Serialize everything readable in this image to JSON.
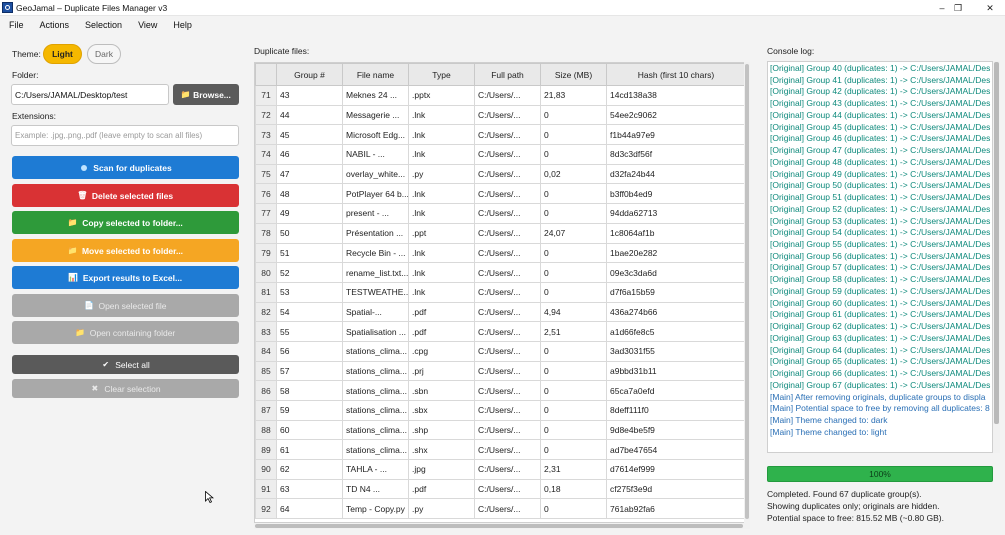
{
  "window": {
    "title": "GeoJamal – Duplicate Files Manager v3",
    "controls": {
      "minimize": "–",
      "maximize": "❐",
      "close": "✕"
    }
  },
  "menu": [
    "File",
    "Actions",
    "Selection",
    "View",
    "Help"
  ],
  "left": {
    "theme_label": "Theme:",
    "theme_light": "Light",
    "theme_dark": "Dark",
    "folder_label": "Folder:",
    "folder_value": "C:/Users/JAMAL/Desktop/test",
    "browse_label": "Browse...",
    "extensions_label": "Extensions:",
    "extensions_placeholder": "Example: .jpg,.png,.pdf (leave empty to scan all files)",
    "buttons": {
      "scan": "Scan for duplicates",
      "delete": "Delete selected files",
      "copy": "Copy selected to folder...",
      "move": "Move selected to folder...",
      "export": "Export results to Excel...",
      "open_file": "Open selected file",
      "open_folder": "Open containing folder",
      "select_all": "Select all",
      "clear_selection": "Clear selection"
    },
    "colors": {
      "scan": "#1e7bd4",
      "delete": "#d93234",
      "copy": "#2e9a3a",
      "move": "#f5a623",
      "export": "#1e7bd4",
      "select_all": "#5a5a5a",
      "clear_selection": "#a9a9a9",
      "theme_accent": "#f5b800"
    }
  },
  "table": {
    "title": "Duplicate files:",
    "columns": [
      "Group #",
      "File name",
      "Type",
      "Full path",
      "Size (MB)",
      "Hash (first 10 chars)"
    ],
    "rows": [
      [
        "71",
        "43",
        "Meknes 24 ...",
        ".pptx",
        "C:/Users/...",
        "21,83",
        "14cd138a38"
      ],
      [
        "72",
        "44",
        "Messagerie ...",
        ".lnk",
        "C:/Users/...",
        "0",
        "54ee2c9062"
      ],
      [
        "73",
        "45",
        "Microsoft Edg...",
        ".lnk",
        "C:/Users/...",
        "0",
        "f1b44a97e9"
      ],
      [
        "74",
        "46",
        "NABIL - ...",
        ".lnk",
        "C:/Users/...",
        "0",
        "8d3c3df56f"
      ],
      [
        "75",
        "47",
        "overlay_white...",
        ".py",
        "C:/Users/...",
        "0,02",
        "d32fa24b44"
      ],
      [
        "76",
        "48",
        "PotPlayer 64 b...",
        ".lnk",
        "C:/Users/...",
        "0",
        "b3ff0b4ed9"
      ],
      [
        "77",
        "49",
        "present - ...",
        ".lnk",
        "C:/Users/...",
        "0",
        "94dda62713"
      ],
      [
        "78",
        "50",
        "Présentation ...",
        ".ppt",
        "C:/Users/...",
        "24,07",
        "1c8064af1b"
      ],
      [
        "79",
        "51",
        "Recycle Bin - ...",
        ".lnk",
        "C:/Users/...",
        "0",
        "1bae20e282"
      ],
      [
        "80",
        "52",
        "rename_list.txt...",
        ".lnk",
        "C:/Users/...",
        "0",
        "09e3c3da6d"
      ],
      [
        "81",
        "53",
        "TESTWEATHE...",
        ".lnk",
        "C:/Users/...",
        "0",
        "d7f6a15b59"
      ],
      [
        "82",
        "54",
        "Spatial-...",
        ".pdf",
        "C:/Users/...",
        "4,94",
        "436a274b66"
      ],
      [
        "83",
        "55",
        "Spatialisation ...",
        ".pdf",
        "C:/Users/...",
        "2,51",
        "a1d66fe8c5"
      ],
      [
        "84",
        "56",
        "stations_clima...",
        ".cpg",
        "C:/Users/...",
        "0",
        "3ad3031f55"
      ],
      [
        "85",
        "57",
        "stations_clima...",
        ".prj",
        "C:/Users/...",
        "0",
        "a9bbd31b11"
      ],
      [
        "86",
        "58",
        "stations_clima...",
        ".sbn",
        "C:/Users/...",
        "0",
        "65ca7a0efd"
      ],
      [
        "87",
        "59",
        "stations_clima...",
        ".sbx",
        "C:/Users/...",
        "0",
        "8deff111f0"
      ],
      [
        "88",
        "60",
        "stations_clima...",
        ".shp",
        "C:/Users/...",
        "0",
        "9d8e4be5f9"
      ],
      [
        "89",
        "61",
        "stations_clima...",
        ".shx",
        "C:/Users/...",
        "0",
        "ad7be47654"
      ],
      [
        "90",
        "62",
        "TAHLA - ...",
        ".jpg",
        "C:/Users/...",
        "2,31",
        "d7614ef999"
      ],
      [
        "91",
        "63",
        "TD N4 ...",
        ".pdf",
        "C:/Users/...",
        "0,18",
        "cf275f3e9d"
      ],
      [
        "92",
        "64",
        "Temp - Copy.py",
        ".py",
        "C:/Users/...",
        "0",
        "761ab92fa6"
      ]
    ]
  },
  "console": {
    "title": "Console log:",
    "lines": [
      {
        "text": "[Original] Group 40 (duplicates: 1) -> C:/Users/JAMAL/Des",
        "kind": "original"
      },
      {
        "text": "[Original] Group 41 (duplicates: 1) -> C:/Users/JAMAL/Des",
        "kind": "original"
      },
      {
        "text": "[Original] Group 42 (duplicates: 1) -> C:/Users/JAMAL/Des",
        "kind": "original"
      },
      {
        "text": "[Original] Group 43 (duplicates: 1) -> C:/Users/JAMAL/Des",
        "kind": "original"
      },
      {
        "text": "[Original] Group 44 (duplicates: 1) -> C:/Users/JAMAL/Des",
        "kind": "original"
      },
      {
        "text": "[Original] Group 45 (duplicates: 1) -> C:/Users/JAMAL/Des",
        "kind": "original"
      },
      {
        "text": "[Original] Group 46 (duplicates: 1) -> C:/Users/JAMAL/Des",
        "kind": "original"
      },
      {
        "text": "[Original] Group 47 (duplicates: 1) -> C:/Users/JAMAL/Des",
        "kind": "original"
      },
      {
        "text": "[Original] Group 48 (duplicates: 1) -> C:/Users/JAMAL/Des",
        "kind": "original"
      },
      {
        "text": "[Original] Group 49 (duplicates: 1) -> C:/Users/JAMAL/Des",
        "kind": "original"
      },
      {
        "text": "[Original] Group 50 (duplicates: 1) -> C:/Users/JAMAL/Des",
        "kind": "original"
      },
      {
        "text": "[Original] Group 51 (duplicates: 1) -> C:/Users/JAMAL/Des",
        "kind": "original"
      },
      {
        "text": "[Original] Group 52 (duplicates: 1) -> C:/Users/JAMAL/Des",
        "kind": "original"
      },
      {
        "text": "[Original] Group 53 (duplicates: 1) -> C:/Users/JAMAL/Des",
        "kind": "original"
      },
      {
        "text": "[Original] Group 54 (duplicates: 1) -> C:/Users/JAMAL/Des",
        "kind": "original"
      },
      {
        "text": "[Original] Group 55 (duplicates: 1) -> C:/Users/JAMAL/Des",
        "kind": "original"
      },
      {
        "text": "[Original] Group 56 (duplicates: 1) -> C:/Users/JAMAL/Des",
        "kind": "original"
      },
      {
        "text": "[Original] Group 57 (duplicates: 1) -> C:/Users/JAMAL/Des",
        "kind": "original"
      },
      {
        "text": "[Original] Group 58 (duplicates: 1) -> C:/Users/JAMAL/Des",
        "kind": "original"
      },
      {
        "text": "[Original] Group 59 (duplicates: 1) -> C:/Users/JAMAL/Des",
        "kind": "original"
      },
      {
        "text": "[Original] Group 60 (duplicates: 1) -> C:/Users/JAMAL/Des",
        "kind": "original"
      },
      {
        "text": "[Original] Group 61 (duplicates: 1) -> C:/Users/JAMAL/Des",
        "kind": "original"
      },
      {
        "text": "[Original] Group 62 (duplicates: 1) -> C:/Users/JAMAL/Des",
        "kind": "original"
      },
      {
        "text": "[Original] Group 63 (duplicates: 1) -> C:/Users/JAMAL/Des",
        "kind": "original"
      },
      {
        "text": "[Original] Group 64 (duplicates: 1) -> C:/Users/JAMAL/Des",
        "kind": "original"
      },
      {
        "text": "[Original] Group 65 (duplicates: 1) -> C:/Users/JAMAL/Des",
        "kind": "original"
      },
      {
        "text": "[Original] Group 66 (duplicates: 1) -> C:/Users/JAMAL/Des",
        "kind": "original"
      },
      {
        "text": "[Original] Group 67 (duplicates: 1) -> C:/Users/JAMAL/Des",
        "kind": "original"
      },
      {
        "text": "[Main] After removing originals, duplicate groups to displa",
        "kind": "main"
      },
      {
        "text": "[Main] Potential space to free by removing all duplicates: 8",
        "kind": "main"
      },
      {
        "text": "[Main] Theme changed to: dark",
        "kind": "main"
      },
      {
        "text": "[Main] Theme changed to: light",
        "kind": "main"
      }
    ],
    "progress_text": "100%",
    "progress_value": 1.0,
    "status_lines": [
      "Completed. Found 67 duplicate group(s).",
      "Showing duplicates only; originals are hidden.",
      "Potential space to free: 815.52 MB (~0.80 GB)."
    ]
  },
  "icons": {
    "scan": "dot-icon",
    "delete": "trash-icon",
    "copy": "folder-icon",
    "move": "folder-icon",
    "export": "spreadsheet-icon",
    "open_file": "file-icon",
    "open_folder": "folder-icon",
    "select_all": "check-icon",
    "clear_selection": "x-icon"
  }
}
